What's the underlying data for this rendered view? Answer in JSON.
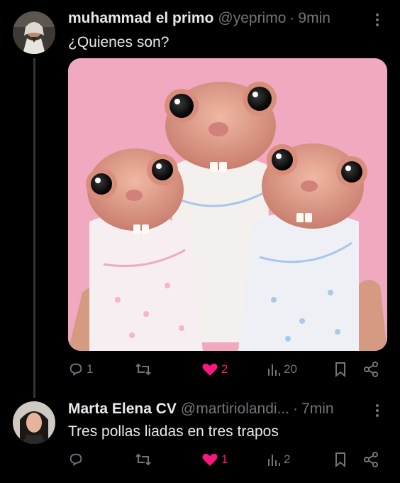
{
  "tweets": [
    {
      "name": "muhammad el primo",
      "handle": "@yeprimo",
      "separator": "·",
      "time": "9min",
      "text": "¿Quienes son?",
      "stats": {
        "replies": "1",
        "likes": "2",
        "views": "20"
      },
      "liked": true
    },
    {
      "name": "Marta Elena CV",
      "handle": "@martiriolandi...",
      "separator": "·",
      "time": "7min",
      "text": "Tres pollas liadas en tres trapos",
      "stats": {
        "replies": "",
        "likes": "1",
        "views": "2"
      },
      "liked": true
    }
  ],
  "icons": {
    "reply": "reply-icon",
    "retweet": "retweet-icon",
    "like": "heart-icon",
    "views": "views-icon",
    "bookmark": "bookmark-icon",
    "share": "share-icon",
    "more": "more-options-icon"
  },
  "colors": {
    "background": "#000000",
    "text": "#e7e9ea",
    "muted": "#71767b",
    "like": "#f91880",
    "media_bg": "#f1a9c0"
  }
}
